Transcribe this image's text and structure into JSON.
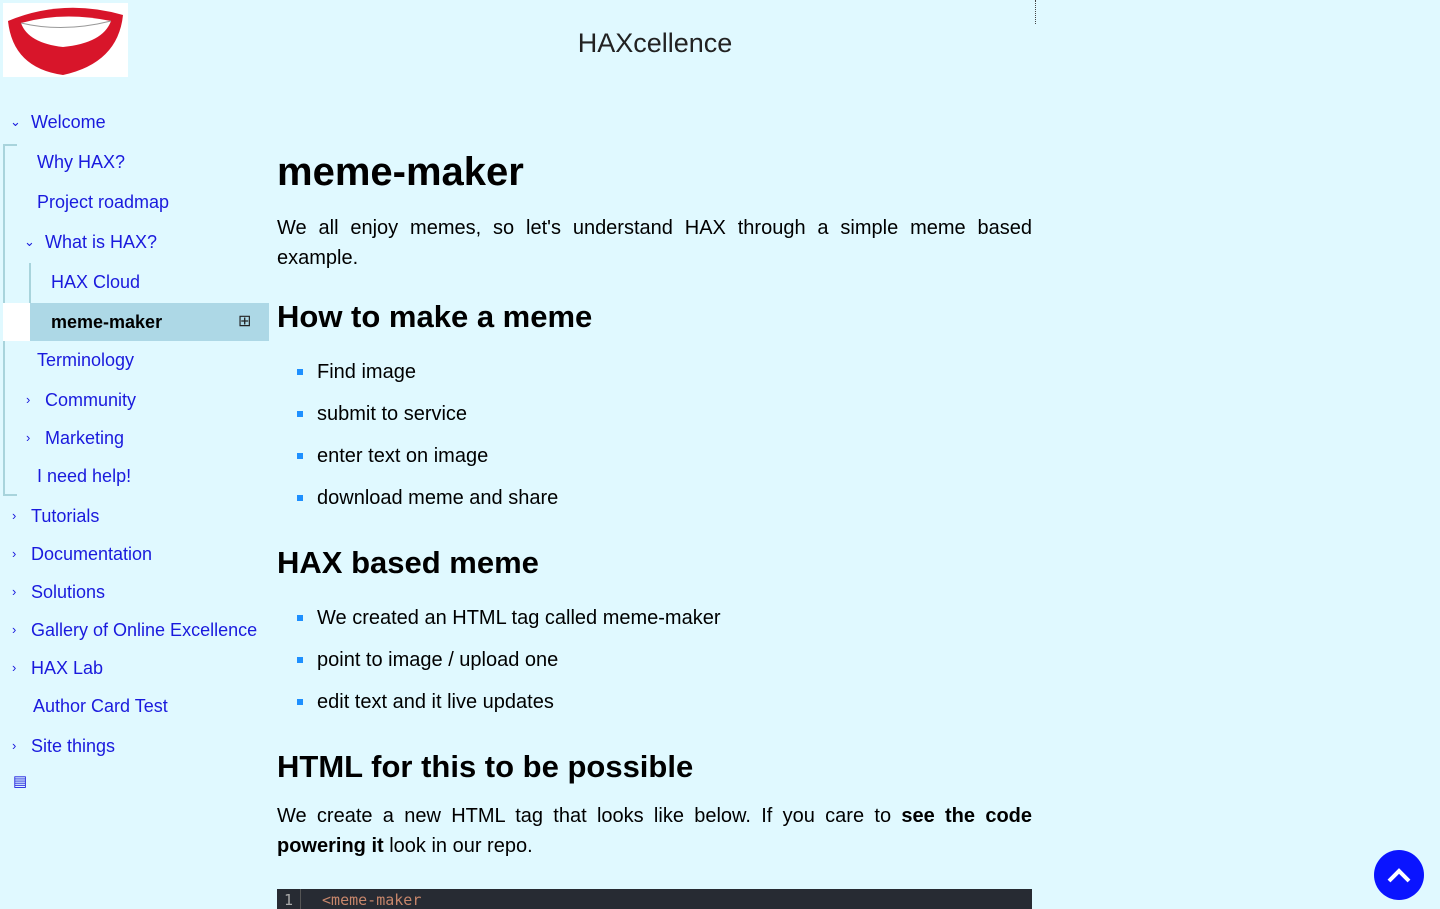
{
  "site": {
    "title": "HAXcellence"
  },
  "nav": {
    "welcome": "Welcome",
    "why": "Why HAX?",
    "roadmap": "Project roadmap",
    "what": "What is HAX?",
    "cloud": "HAX Cloud",
    "meme": "meme-maker",
    "terminology": "Terminology",
    "community": "Community",
    "marketing": "Marketing",
    "help": "I need help!",
    "tutorials": "Tutorials",
    "documentation": "Documentation",
    "solutions": "Solutions",
    "gallery": "Gallery of Online Excellence",
    "lab": "HAX Lab",
    "author": "Author Card Test",
    "site": "Site things"
  },
  "main": {
    "title": "meme-maker",
    "intro": "We all enjoy memes, so let's understand HAX through a simple meme based example.",
    "h_make": "How to make a meme",
    "make_items": [
      "Find image",
      "submit to service",
      "enter text on image",
      "download meme and share"
    ],
    "h_based": "HAX based meme",
    "based_items": [
      "We created an HTML tag called meme-maker",
      "point to image / upload one",
      "edit text and it live updates"
    ],
    "h_html": "HTML for this to be possible",
    "html_p1": "We create a new HTML tag that looks like below. If you care to ",
    "html_bold": "see the code powering it",
    "html_p2": " look in our repo.",
    "code_line": "1",
    "code_text": "<meme-maker"
  }
}
